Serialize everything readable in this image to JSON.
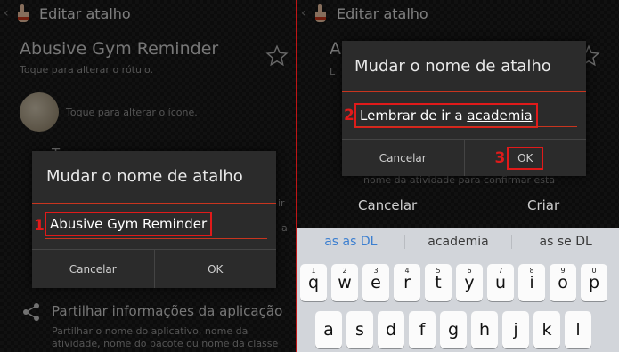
{
  "action_bar": {
    "title": "Editar atalho"
  },
  "left": {
    "app_title": "Abusive Gym Reminder",
    "app_subtitle": "Toque para alterar o rótulo.",
    "icon_subtitle": "Toque para alterar o ícone.",
    "partial_T": "T",
    "partial_ir": "ir",
    "partial_a": "a",
    "share_title": "Partilhar informações da aplicação",
    "share_subtitle": [
      "Partilhar o nome do aplicativo, nome da",
      "atividade, nome do pacote ou nome da classe"
    ],
    "dialog": {
      "title": "Mudar o nome de atalho",
      "step": "1",
      "value": "Abusive Gym Reminder",
      "cancel": "Cancelar",
      "ok": "OK"
    }
  },
  "right": {
    "partial_A": "A",
    "partial_L": "L",
    "bg_text": "nome da atividade para confirmar esta",
    "bg_cancel": "Cancelar",
    "bg_create": "Criar",
    "dialog": {
      "title": "Mudar o nome de atalho",
      "step_input": "2",
      "value_prefix": "Lembrar de ir a ",
      "value_word": "academia",
      "step_ok": "3",
      "cancel": "Cancelar",
      "ok": "OK"
    },
    "suggestions": [
      "as as DL",
      "academia",
      "as se DL"
    ],
    "keyboard": {
      "row1": [
        {
          "k": "q",
          "n": "1"
        },
        {
          "k": "w",
          "n": "2"
        },
        {
          "k": "e",
          "n": "3"
        },
        {
          "k": "r",
          "n": "4"
        },
        {
          "k": "t",
          "n": "5"
        },
        {
          "k": "y",
          "n": "6"
        },
        {
          "k": "u",
          "n": "7"
        },
        {
          "k": "i",
          "n": "8"
        },
        {
          "k": "o",
          "n": "9"
        },
        {
          "k": "p",
          "n": "0"
        }
      ],
      "row2": [
        "a",
        "s",
        "d",
        "f",
        "g",
        "h",
        "j",
        "k",
        "l"
      ]
    }
  },
  "colors": {
    "accent_red": "#e01a1a",
    "dialog_line": "#c8351f",
    "suggestion_blue": "#3c7fd0"
  }
}
